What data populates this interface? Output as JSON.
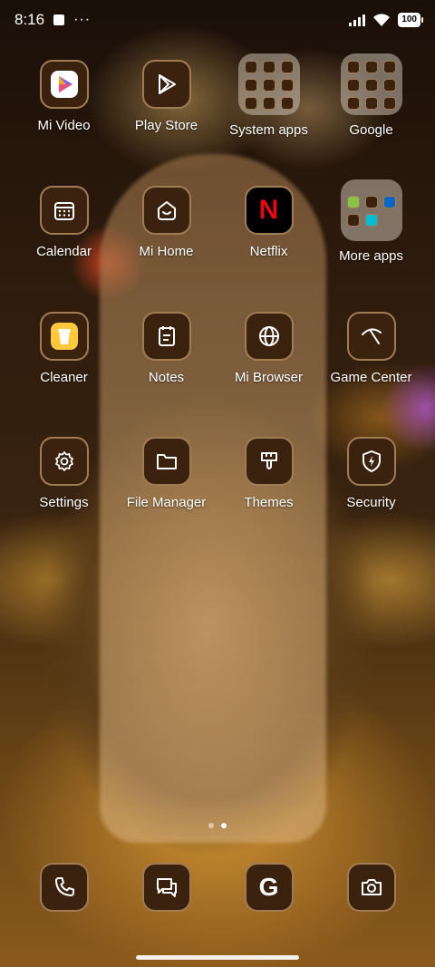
{
  "status_bar": {
    "time": "8:16",
    "more": "···",
    "battery": "100"
  },
  "apps": [
    {
      "label": "Mi Video",
      "icon": "mi-video-icon"
    },
    {
      "label": "Play Store",
      "icon": "play-store-icon"
    },
    {
      "label": "System apps",
      "icon": "folder-icon"
    },
    {
      "label": "Google",
      "icon": "folder-icon"
    },
    {
      "label": "Calendar",
      "icon": "calendar-icon"
    },
    {
      "label": "Mi Home",
      "icon": "mi-home-icon"
    },
    {
      "label": "Netflix",
      "icon": "netflix-icon",
      "glyph": "N"
    },
    {
      "label": "More apps",
      "icon": "folder-icon"
    },
    {
      "label": "Cleaner",
      "icon": "cleaner-icon"
    },
    {
      "label": "Notes",
      "icon": "notes-icon"
    },
    {
      "label": "Mi Browser",
      "icon": "globe-icon"
    },
    {
      "label": "Game Center",
      "icon": "game-center-icon"
    },
    {
      "label": "Settings",
      "icon": "gear-icon"
    },
    {
      "label": "File Manager",
      "icon": "folder-outline-icon"
    },
    {
      "label": "Themes",
      "icon": "brush-icon"
    },
    {
      "label": "Security",
      "icon": "shield-icon"
    }
  ],
  "dock": [
    {
      "icon": "phone-icon"
    },
    {
      "icon": "messages-icon"
    },
    {
      "icon": "google-icon",
      "glyph": "G"
    },
    {
      "icon": "camera-icon"
    }
  ],
  "colors": {
    "icon_bg": "#3a220f",
    "icon_border": "#a07c55",
    "netflix_red": "#e50914"
  },
  "page_indicator": {
    "pages": 2,
    "current": 2
  }
}
